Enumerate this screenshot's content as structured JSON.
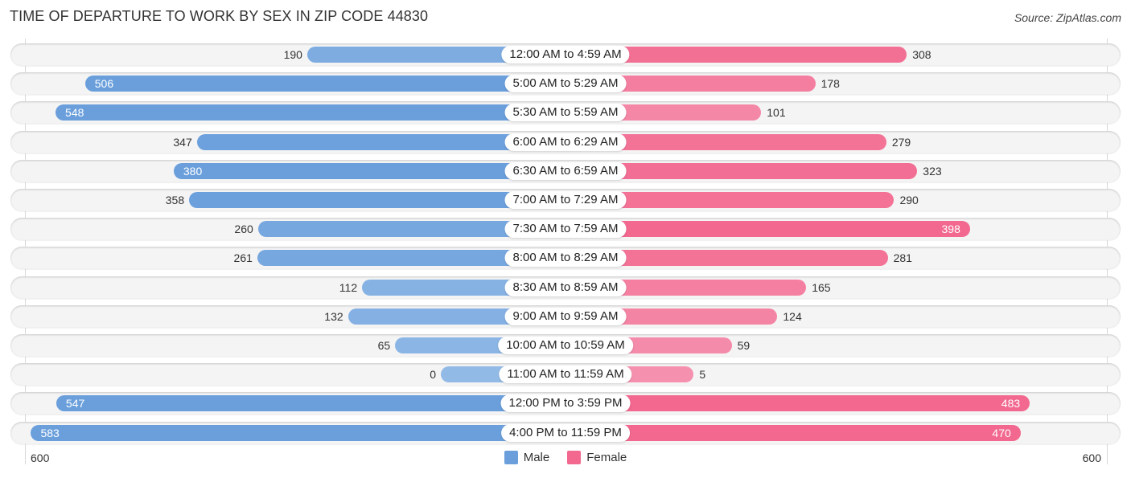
{
  "title": "TIME OF DEPARTURE TO WORK BY SEX IN ZIP CODE 44830",
  "source": "Source: ZipAtlas.com",
  "colors": {
    "male": "#6a9fdc",
    "male_light": "#a8c8ec",
    "female": "#f2688f",
    "female_light": "#f7a8c0"
  },
  "chart_data": {
    "type": "bar",
    "orientation": "horizontal-butterfly",
    "title": "TIME OF DEPARTURE TO WORK BY SEX IN ZIP CODE 44830",
    "xlabel": "",
    "ylabel": "",
    "xlim": [
      0,
      600
    ],
    "axis_tick_labels": {
      "left": "600",
      "right": "600"
    },
    "legend_position": "bottom",
    "categories": [
      "12:00 AM to 4:59 AM",
      "5:00 AM to 5:29 AM",
      "5:30 AM to 5:59 AM",
      "6:00 AM to 6:29 AM",
      "6:30 AM to 6:59 AM",
      "7:00 AM to 7:29 AM",
      "7:30 AM to 7:59 AM",
      "8:00 AM to 8:29 AM",
      "8:30 AM to 8:59 AM",
      "9:00 AM to 9:59 AM",
      "10:00 AM to 10:59 AM",
      "11:00 AM to 11:59 AM",
      "12:00 PM to 3:59 PM",
      "4:00 PM to 11:59 PM"
    ],
    "series": [
      {
        "name": "Male",
        "values": [
          190,
          506,
          548,
          347,
          380,
          358,
          260,
          261,
          112,
          132,
          65,
          0,
          547,
          583
        ]
      },
      {
        "name": "Female",
        "values": [
          308,
          178,
          101,
          279,
          323,
          290,
          398,
          281,
          165,
          124,
          59,
          5,
          483,
          470
        ]
      }
    ]
  }
}
